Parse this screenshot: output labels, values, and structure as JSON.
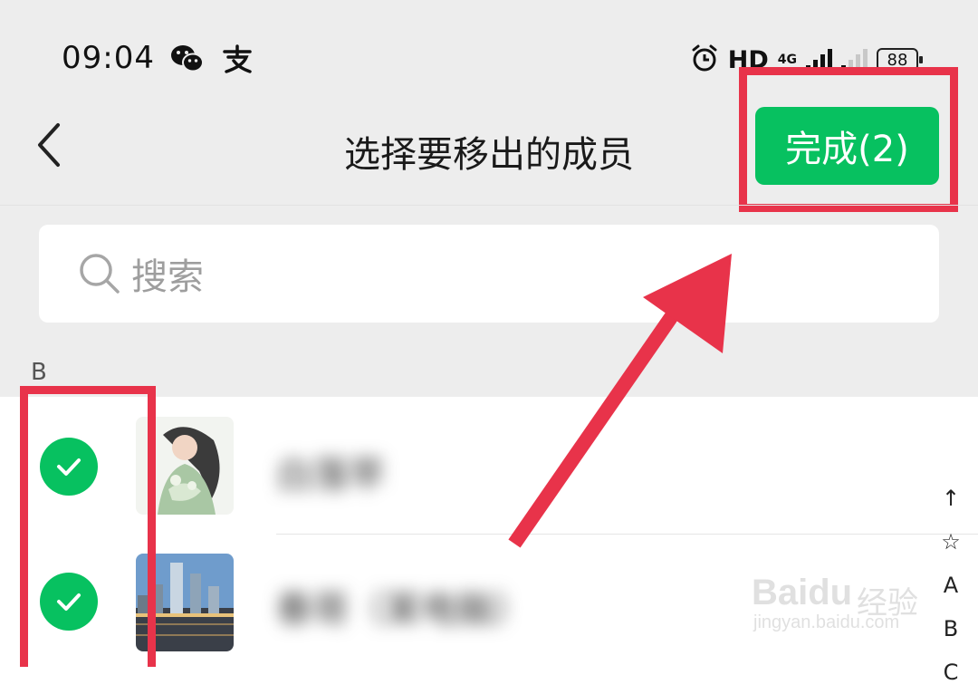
{
  "status_bar": {
    "time": "09:04",
    "app_icons": [
      "wechat-icon",
      "alipay-icon"
    ],
    "hd": "HD",
    "network": "4G",
    "battery": "88"
  },
  "nav": {
    "title": "选择要移出的成员",
    "done_label": "完成(2)"
  },
  "search": {
    "placeholder": "搜索"
  },
  "section": {
    "letter": "B"
  },
  "members": [
    {
      "name": "白落苹",
      "selected": true
    },
    {
      "name": "春哥（某电脑）",
      "selected": true
    }
  ],
  "index_bar": [
    "↑",
    "☆",
    "A",
    "B",
    "C"
  ],
  "watermark": {
    "brand": "Baidu",
    "cn": "经验",
    "url": "jingyan.baidu.com"
  },
  "colors": {
    "accent": "#07c160",
    "highlight": "#e8334a",
    "background": "#ededed"
  }
}
